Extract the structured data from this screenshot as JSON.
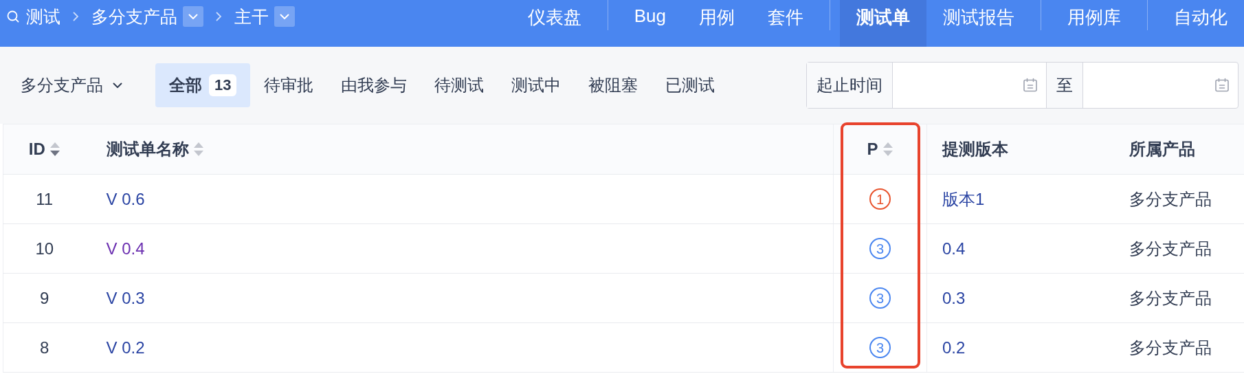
{
  "breadcrumb": {
    "items": [
      {
        "label": "测试",
        "dropdown": false
      },
      {
        "label": "多分支产品",
        "dropdown": true
      },
      {
        "label": "主干",
        "dropdown": true
      }
    ]
  },
  "nav_groups": [
    {
      "items": [
        {
          "label": "仪表盘",
          "selected": false
        }
      ]
    },
    {
      "items": [
        {
          "label": "Bug",
          "selected": false
        },
        {
          "label": "用例",
          "selected": false
        },
        {
          "label": "套件",
          "selected": false
        }
      ]
    },
    {
      "items": [
        {
          "label": "测试单",
          "selected": true
        },
        {
          "label": "测试报告",
          "selected": false
        }
      ]
    },
    {
      "items": [
        {
          "label": "用例库",
          "selected": false
        }
      ]
    },
    {
      "items": [
        {
          "label": "自动化",
          "selected": false
        }
      ]
    }
  ],
  "filter": {
    "product": "多分支产品",
    "tabs": [
      {
        "label": "全部",
        "count": "13",
        "selected": true
      },
      {
        "label": "待审批",
        "selected": false
      },
      {
        "label": "由我参与",
        "selected": false
      },
      {
        "label": "待测试",
        "selected": false
      },
      {
        "label": "测试中",
        "selected": false
      },
      {
        "label": "被阻塞",
        "selected": false
      },
      {
        "label": "已测试",
        "selected": false
      }
    ],
    "date_range": {
      "label": "起止时间",
      "separator": "至"
    }
  },
  "table": {
    "columns": [
      {
        "label": "ID",
        "sorted": true,
        "highlighted": false
      },
      {
        "label": "测试单名称",
        "sorted": false,
        "highlighted": false
      },
      {
        "label": "P",
        "sorted": false,
        "highlighted": true
      },
      {
        "label": "提测版本",
        "highlighted": false
      },
      {
        "label": "所属产品",
        "highlighted": false
      }
    ],
    "rows": [
      {
        "id": "11",
        "name": "V 0.6",
        "visited": false,
        "priority": "1",
        "color": "#e8532d",
        "build": "版本1",
        "product": "多分支产品"
      },
      {
        "id": "10",
        "name": "V 0.4",
        "visited": true,
        "priority": "3",
        "color": "#4a86f0",
        "build": "0.4",
        "product": "多分支产品"
      },
      {
        "id": "9",
        "name": "V 0.3",
        "visited": false,
        "priority": "3",
        "color": "#4a86f0",
        "build": "0.3",
        "product": "多分支产品"
      },
      {
        "id": "8",
        "name": "V 0.2",
        "visited": false,
        "priority": "3",
        "color": "#4a86f0",
        "build": "0.2",
        "product": "多分支产品"
      }
    ]
  }
}
